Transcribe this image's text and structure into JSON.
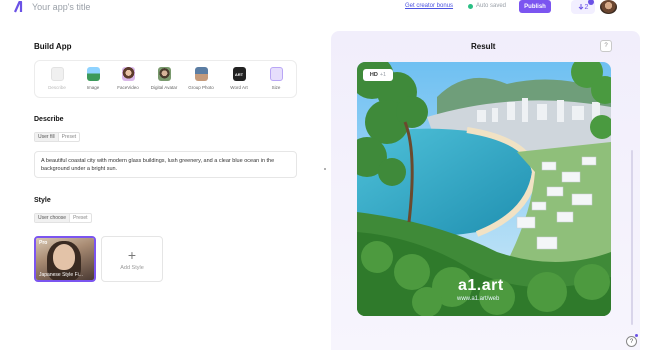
{
  "header": {
    "app_title": "Your app's title",
    "creator_link": "Get creator bonus",
    "autosave": "Auto saved",
    "publish": "Publish",
    "credits": "2"
  },
  "build": {
    "title": "Build App",
    "types": [
      {
        "label": "Describe",
        "icon": "document-icon"
      },
      {
        "label": "Image",
        "icon": "image-icon"
      },
      {
        "label": "FaceVideo",
        "icon": "face-video-icon"
      },
      {
        "label": "Digital Avatar",
        "icon": "digital-avatar-icon"
      },
      {
        "label": "Group Photo",
        "icon": "group-photo-icon"
      },
      {
        "label": "Word Art",
        "icon": "word-art-icon"
      },
      {
        "label": "Size",
        "icon": "size-icon"
      }
    ]
  },
  "describe": {
    "title": "Describe",
    "tabs": [
      "User fill",
      "Preset"
    ],
    "prompt": "A beautiful coastal city with modern glass buildings, lush greenery, and a clear blue ocean in the background under a bright sun."
  },
  "style": {
    "title": "Style",
    "tabs": [
      "User choose",
      "Preset"
    ],
    "card_badge": "Pro",
    "card_caption": "Japanese Style Fi...",
    "add_label": "Add Style"
  },
  "result": {
    "title": "Result",
    "hd_badge": "HD",
    "hd_count": "+1",
    "watermark": "a1.art",
    "watermark_sub": "www.a1.art/web"
  },
  "colors": {
    "accent": "#7b55f0",
    "link": "#4b53e0",
    "saved": "#2bbf84"
  }
}
